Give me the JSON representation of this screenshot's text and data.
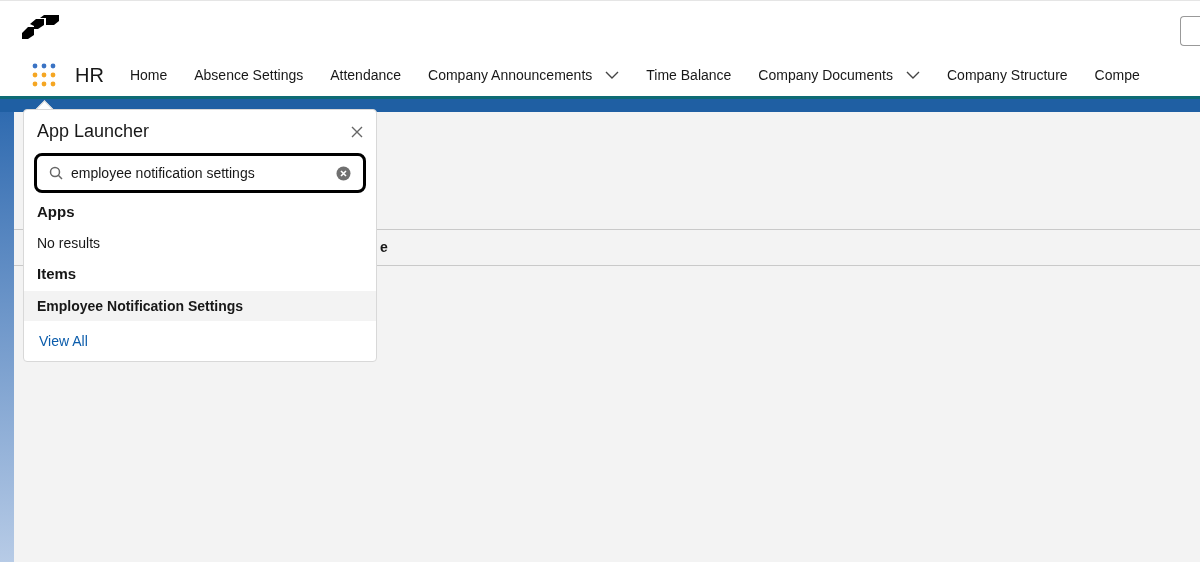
{
  "app_name": "HR",
  "nav": [
    {
      "label": "Home",
      "dropdown": false
    },
    {
      "label": "Absence Settings",
      "dropdown": false
    },
    {
      "label": "Attendance",
      "dropdown": false
    },
    {
      "label": "Company Announcements",
      "dropdown": true
    },
    {
      "label": "Time Balance",
      "dropdown": false
    },
    {
      "label": "Company Documents",
      "dropdown": true
    },
    {
      "label": "Company Structure",
      "dropdown": false
    },
    {
      "label": "Compe",
      "dropdown": false
    }
  ],
  "background_row_text": "e",
  "app_launcher": {
    "title": "App Launcher",
    "search": {
      "value": "employee notification settings"
    },
    "sections": [
      {
        "heading": "Apps",
        "empty_text": "No results"
      },
      {
        "heading": "Items",
        "results": [
          {
            "label": "Employee Notification Settings",
            "selected": true
          }
        ]
      }
    ],
    "view_all": "View All"
  }
}
